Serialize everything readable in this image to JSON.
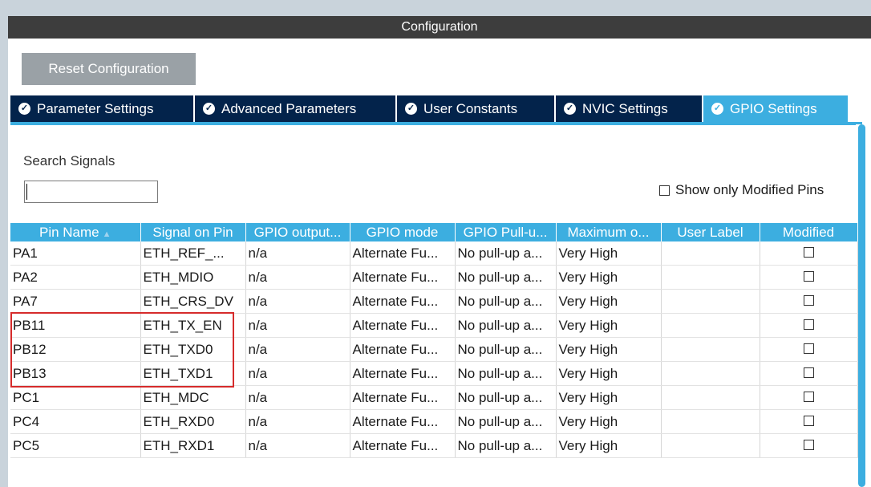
{
  "header": {
    "title": "Configuration"
  },
  "toolbar": {
    "reset_label": "Reset Configuration"
  },
  "tabs": [
    {
      "label": "Parameter Settings",
      "active": false
    },
    {
      "label": "Advanced Parameters",
      "active": false
    },
    {
      "label": "User Constants",
      "active": false
    },
    {
      "label": "NVIC Settings",
      "active": false
    },
    {
      "label": "GPIO Settings",
      "active": true
    }
  ],
  "tab_icon": "check-circle-icon",
  "search": {
    "label": "Search Signals",
    "value": ""
  },
  "filter": {
    "show_modified_label": "Show only Modified Pins",
    "checked": false
  },
  "table": {
    "columns": [
      "Pin Name",
      "Signal on Pin",
      "GPIO output...",
      "GPIO mode",
      "GPIO Pull-u...",
      "Maximum o...",
      "User Label",
      "Modified"
    ],
    "sort_column": "Pin Name",
    "rows": [
      {
        "pin": "PA1",
        "signal": "ETH_REF_...",
        "output": "n/a",
        "mode": "Alternate Fu...",
        "pull": "No pull-up a...",
        "speed": "Very High",
        "label": "",
        "modified": false
      },
      {
        "pin": "PA2",
        "signal": "ETH_MDIO",
        "output": "n/a",
        "mode": "Alternate Fu...",
        "pull": "No pull-up a...",
        "speed": "Very High",
        "label": "",
        "modified": false
      },
      {
        "pin": "PA7",
        "signal": "ETH_CRS_DV",
        "output": "n/a",
        "mode": "Alternate Fu...",
        "pull": "No pull-up a...",
        "speed": "Very High",
        "label": "",
        "modified": false
      },
      {
        "pin": "PB11",
        "signal": "ETH_TX_EN",
        "output": "n/a",
        "mode": "Alternate Fu...",
        "pull": "No pull-up a...",
        "speed": "Very High",
        "label": "",
        "modified": false
      },
      {
        "pin": "PB12",
        "signal": "ETH_TXD0",
        "output": "n/a",
        "mode": "Alternate Fu...",
        "pull": "No pull-up a...",
        "speed": "Very High",
        "label": "",
        "modified": false
      },
      {
        "pin": "PB13",
        "signal": "ETH_TXD1",
        "output": "n/a",
        "mode": "Alternate Fu...",
        "pull": "No pull-up a...",
        "speed": "Very High",
        "label": "",
        "modified": false
      },
      {
        "pin": "PC1",
        "signal": "ETH_MDC",
        "output": "n/a",
        "mode": "Alternate Fu...",
        "pull": "No pull-up a...",
        "speed": "Very High",
        "label": "",
        "modified": false
      },
      {
        "pin": "PC4",
        "signal": "ETH_RXD0",
        "output": "n/a",
        "mode": "Alternate Fu...",
        "pull": "No pull-up a...",
        "speed": "Very High",
        "label": "",
        "modified": false
      },
      {
        "pin": "PC5",
        "signal": "ETH_RXD1",
        "output": "n/a",
        "mode": "Alternate Fu...",
        "pull": "No pull-up a...",
        "speed": "Very High",
        "label": "",
        "modified": false
      }
    ]
  },
  "colors": {
    "accent": "#3caee0",
    "tab_dark": "#03234b",
    "header_dark": "#3d3d3d",
    "highlight": "#d62b2b",
    "button_gray": "#9aa1a6"
  }
}
